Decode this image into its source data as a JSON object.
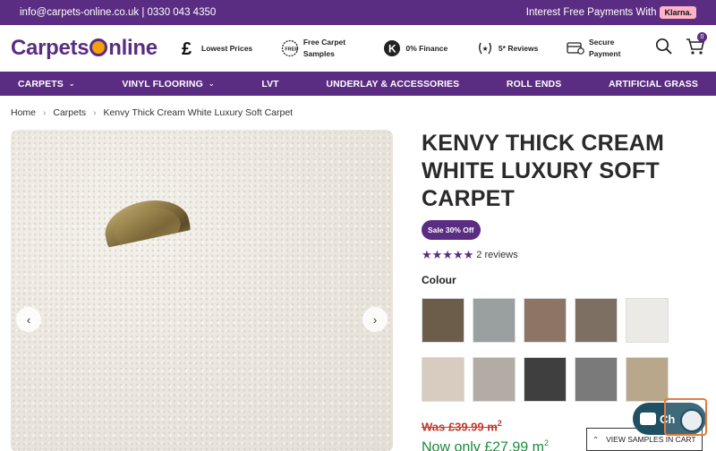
{
  "topbar": {
    "contact": "info@carpets-online.co.uk | 0330 043 4350",
    "payments_text": "Interest Free Payments With",
    "klarna": "Klarna."
  },
  "header": {
    "logo_part1": "Carpets",
    "logo_part2": "nline",
    "usps": [
      {
        "icon": "pound-icon",
        "label": "Lowest Prices"
      },
      {
        "icon": "free-sample-icon",
        "label": "Free Carpet Samples"
      },
      {
        "icon": "klarna-k-icon",
        "label": "0% Finance"
      },
      {
        "icon": "laurel-icon",
        "label": "5* Reviews"
      },
      {
        "icon": "secure-card-icon",
        "label": "Secure Payment"
      }
    ],
    "cart_count": "0"
  },
  "nav": {
    "items": [
      {
        "label": "CARPETS",
        "dropdown": true
      },
      {
        "label": "VINYL FLOORING",
        "dropdown": true
      },
      {
        "label": "LVT",
        "dropdown": false
      },
      {
        "label": "UNDERLAY & ACCESSORIES",
        "dropdown": false
      },
      {
        "label": "ROLL ENDS",
        "dropdown": false
      },
      {
        "label": "ARTIFICIAL GRASS",
        "dropdown": false
      }
    ]
  },
  "breadcrumb": [
    "Home",
    "Carpets",
    "Kenvy Thick Cream White Luxury Soft Carpet"
  ],
  "product": {
    "title": "KENVY THICK CREAM WHITE LUXURY SOFT CARPET",
    "sale_badge": "Sale 30% Off",
    "stars": "★★★★★",
    "reviews": "2 reviews",
    "colour_label": "Colour",
    "swatches": [
      "#6b5d4a",
      "#9aa0a0",
      "#8c7565",
      "#7d7063",
      "#eceae6",
      "#d8cbc0",
      "#b3aca5",
      "#3f3f3f",
      "#7a7a7a",
      "#b8a78a"
    ],
    "was_price": "Was £39.99 m",
    "now_price": "Now only £27.99 m",
    "unit_sup": "2"
  },
  "overlays": {
    "samples_button": "VIEW SAMPLES IN CART",
    "chat_label": "Ch"
  },
  "colors": {
    "brand_purple": "#5b2d82",
    "sale_red": "#c0392b",
    "now_green": "#1a8a3a"
  }
}
